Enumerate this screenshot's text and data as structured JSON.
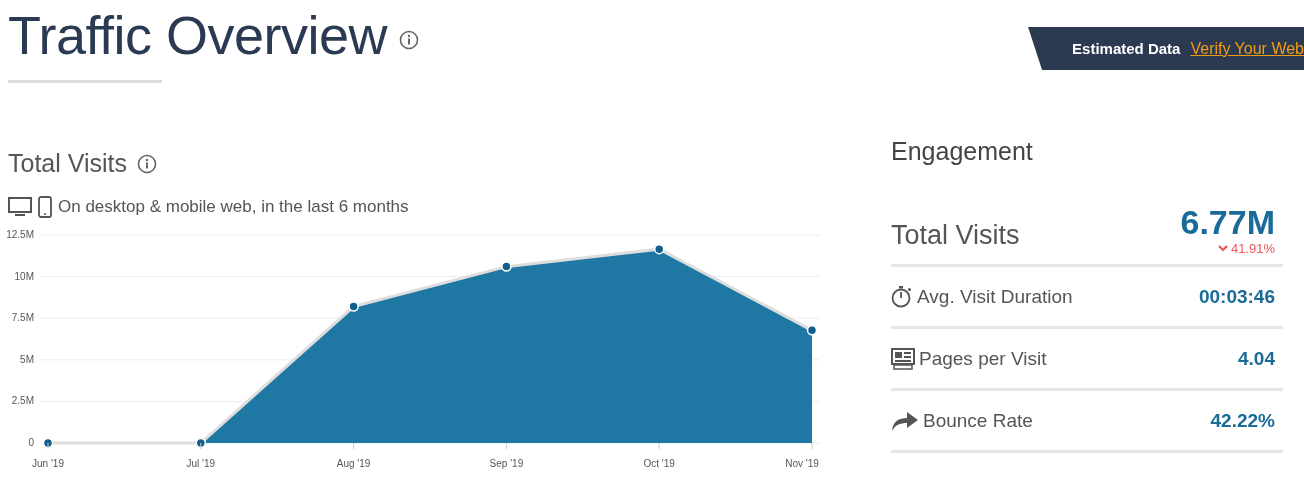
{
  "header": {
    "title": "Traffic Overview",
    "banner": {
      "label": "Estimated Data",
      "link": "Verify Your Web"
    }
  },
  "total_visits": {
    "title": "Total Visits",
    "subtitle": "On desktop & mobile web, in the last 6 months",
    "chart_data": {
      "type": "area",
      "categories": [
        "Jun '19",
        "Jul '19",
        "Aug '19",
        "Sep '19",
        "Oct '19",
        "Nov '19"
      ],
      "grid": true,
      "series": [
        {
          "color": "#1f77a4",
          "values": [
            0,
            0,
            8.2,
            10.6,
            11.65,
            6.77
          ]
        }
      ],
      "ylim": [
        0,
        12.5
      ],
      "yticks": [
        {
          "value": 0,
          "label": "0"
        },
        {
          "value": 2.5,
          "label": "2.5M"
        },
        {
          "value": 5,
          "label": "5M"
        },
        {
          "value": 7.5,
          "label": "7.5M"
        },
        {
          "value": 10,
          "label": "10M"
        },
        {
          "value": 12.5,
          "label": "12.5M"
        }
      ]
    }
  },
  "engagement": {
    "title": "Engagement",
    "total": {
      "label": "Total Visits",
      "value": "6.77M",
      "change": "41.91%",
      "declined": true
    },
    "metrics": [
      {
        "kind": "stopwatch",
        "label": "Avg. Visit Duration",
        "value": "00:03:46"
      },
      {
        "kind": "pages",
        "label": "Pages per Visit",
        "value": "4.04"
      },
      {
        "kind": "share",
        "label": "Bounce Rate",
        "value": "42.22%"
      }
    ]
  }
}
